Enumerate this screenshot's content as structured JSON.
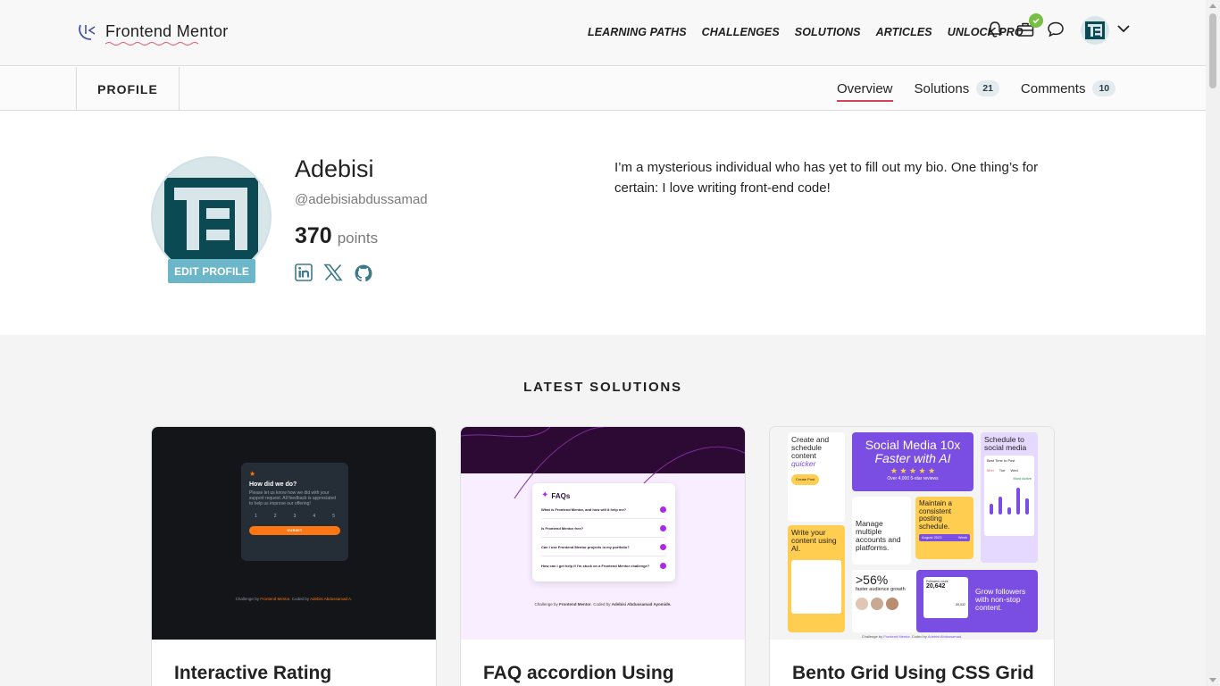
{
  "brand": {
    "name": "Frontend Mentor"
  },
  "nav": {
    "links": [
      "LEARNING PATHS",
      "CHALLENGES",
      "SOLUTIONS",
      "ARTICLES",
      "UNLOCK PRO"
    ],
    "icons": [
      "bell-icon",
      "briefcase-icon",
      "chat-icon",
      "avatar",
      "chevron-down-icon"
    ]
  },
  "subnav": {
    "profile_label": "PROFILE",
    "tabs": [
      {
        "label": "Overview",
        "count": null,
        "active": true
      },
      {
        "label": "Solutions",
        "count": "21",
        "active": false
      },
      {
        "label": "Comments",
        "count": "10",
        "active": false
      }
    ]
  },
  "profile": {
    "name": "Adebisi",
    "handle": "@adebisiabdussamad",
    "points_value": "370",
    "points_label": "points",
    "edit_label": "EDIT PROFILE",
    "bio": "I’m a mysterious individual who has yet to fill out my bio. One thing’s for certain: I love writing front-end code!",
    "socials": [
      "linkedin-icon",
      "x-icon",
      "github-icon"
    ]
  },
  "latest": {
    "heading": "LATEST SOLUTIONS",
    "cards": [
      {
        "title": "Interactive Rating",
        "thumb": {
          "heading": "How did we do?",
          "body": "Please let us know how we did with your support request. All feedback is appreciated to help us improve our offering!",
          "ratings": [
            "1",
            "2",
            "3",
            "4",
            "5"
          ],
          "button": "SUBMIT",
          "credit_prefix": "Challenge by",
          "credit_brand": "Frontend Mentor",
          "credit_mid": ". Coded by",
          "credit_author": "Adebisi Abdussamad A."
        }
      },
      {
        "title": "FAQ accordion Using",
        "thumb": {
          "heading": "FAQs",
          "questions": [
            "What is Frontend Mentor, and how will it help me?",
            "Is Frontend Mentor free?",
            "Can I use Frontend Mentor projects in my portfolio?",
            "How can I get help if I'm stuck on a Frontend Mentor challenge?"
          ],
          "credit_prefix": "Challenge by",
          "credit_brand": "Frontend Mentor",
          "credit_mid": ". Coded by",
          "credit_author": "Adebisi Abdussamad Ayomide."
        }
      },
      {
        "title": "Bento Grid Using CSS Grid",
        "thumb": {
          "cell1": "Create and schedule content",
          "cell1_accent": "quicker",
          "cell1_button": "Create Post",
          "hero_line1": "Social Media 10x",
          "hero_line2": "Faster with AI",
          "hero_stars": "★ ★ ★ ★ ★",
          "hero_reviews": "Over 4,000 5-star reviews",
          "schedule": "Schedule to social media",
          "best_time": "Best Time to Post",
          "days": [
            "Mon",
            "Tue",
            "Wed"
          ],
          "most_active": "Most Active",
          "write": "Write your content using AI.",
          "manage": "Manage multiple accounts and platforms.",
          "maintain": "Maintain a consistent posting schedule.",
          "calendar_month": "August 2023",
          "calendar_tag": "Week",
          "stat": ">56%",
          "stat_desc": "faster audience growth",
          "grow": "Grow followers with non-stop content.",
          "followers_label": "Followers count",
          "followers_count": "20,642",
          "followers_small": "89,532",
          "credit_prefix": "Challenge by",
          "credit_brand": "Frontend Mentor",
          "credit_mid": ". Coded by",
          "credit_author": "Adebisi Abdussamad."
        }
      }
    ]
  },
  "colors": {
    "accent_red": "#d5455a",
    "teal": "#6bb6c9",
    "dark_teal": "#0b4a52",
    "orange": "#fc7614",
    "purple": "#7a4de3"
  }
}
